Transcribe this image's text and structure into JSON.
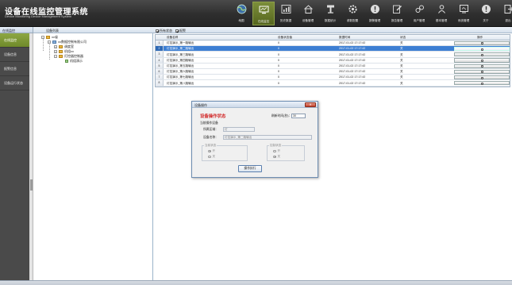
{
  "app": {
    "title": "设备在线监控管理系统",
    "subtitle": "Device Monitoring Device Management System"
  },
  "nav": [
    {
      "label": "地图",
      "icon": "globe-icon",
      "active": false
    },
    {
      "label": "在线监控",
      "icon": "monitor-icon",
      "active": true
    },
    {
      "label": "历史数据",
      "icon": "chart-icon",
      "active": false
    },
    {
      "label": "设备管理",
      "icon": "house-icon",
      "active": false
    },
    {
      "label": "数据统计",
      "icon": "filter-icon",
      "active": false
    },
    {
      "label": "参数配置",
      "icon": "gear-icon",
      "active": false
    },
    {
      "label": "报警管理",
      "icon": "alert-icon",
      "active": false
    },
    {
      "label": "报告管理",
      "icon": "edit-icon",
      "active": false
    },
    {
      "label": "用户管理",
      "icon": "users-icon",
      "active": false
    },
    {
      "label": "基本管理",
      "icon": "user-icon",
      "active": false
    },
    {
      "label": "系统管理",
      "icon": "screen-icon",
      "active": false
    },
    {
      "label": "关于",
      "icon": "info-icon",
      "active": false
    },
    {
      "label": "退出",
      "icon": "exit-icon",
      "active": false
    }
  ],
  "rail": {
    "header": "在线监控",
    "items": [
      {
        "label": "在线监控",
        "active": true
      },
      {
        "label": "设备信息",
        "active": false
      },
      {
        "label": "报警信息",
        "active": false
      },
      {
        "label": "设备运行状态",
        "active": false
      }
    ]
  },
  "tree": {
    "header": "设备列表",
    "nodes": [
      {
        "label": "xx省",
        "kind": "folder"
      },
      {
        "label": "xx数据控制有限公司",
        "kind": "pc"
      },
      {
        "label": "调度室",
        "kind": "folder"
      },
      {
        "label": "机组xx",
        "kind": "folder"
      },
      {
        "label": "灯控器控制器",
        "kind": "folder"
      },
      {
        "label": "机组演示",
        "kind": "dev"
      }
    ]
  },
  "toolbar": {
    "items": [
      {
        "label": "所有状态",
        "checked": true
      },
      {
        "label": "报警",
        "checked": true
      }
    ]
  },
  "grid": {
    "columns": [
      "设备名称",
      "设备状态值",
      "数据时间",
      "状态",
      "操作"
    ],
    "rows": [
      {
        "no": "1",
        "name": "灯控演示_第一路输出",
        "value": "0",
        "time": "2017-01-02  17:17:43",
        "status": "关",
        "selected": false
      },
      {
        "no": "2",
        "name": "灯控演示_第二路输出",
        "value": "0",
        "time": "2017-01-02  17:17:43",
        "status": "关",
        "selected": true
      },
      {
        "no": "3",
        "name": "灯控演示_第三路输出",
        "value": "0",
        "time": "2017-01-02  17:17:43",
        "status": "关",
        "selected": false
      },
      {
        "no": "4",
        "name": "灯控演示_第四路输出",
        "value": "0",
        "time": "2017-01-02  17:17:43",
        "status": "关",
        "selected": false
      },
      {
        "no": "5",
        "name": "灯控演示_第五路输出",
        "value": "0",
        "time": "2017-01-02  17:17:43",
        "status": "关",
        "selected": false
      },
      {
        "no": "6",
        "name": "灯控演示_第六路输出",
        "value": "0",
        "time": "2017-01-02  17:17:43",
        "status": "关",
        "selected": false
      },
      {
        "no": "7",
        "name": "灯控演示_第七路输出",
        "value": "0",
        "time": "2017-01-02  17:17:43",
        "status": "关",
        "selected": false
      },
      {
        "no": "8",
        "name": "灯控演示_第八路输出",
        "value": "0",
        "time": "2017-01-02  17:17:43",
        "status": "关",
        "selected": false
      }
    ]
  },
  "dialog": {
    "title": "设备操作",
    "close_label": "✕",
    "state_text": "设备操作状态",
    "refresh_label": "刷新时间(秒)：",
    "refresh_value": "30",
    "section_label": "当前操作设备",
    "region_label": "所属区域：",
    "region_value": "灯",
    "device_label": "设备名称：",
    "device_value": "灯控演示_第二路输出",
    "group1_title": "当前状态",
    "group1_options": [
      {
        "label": "开",
        "checked": true
      },
      {
        "label": "关",
        "checked": false
      }
    ],
    "group2_title": "控制状态",
    "group2_options": [
      {
        "label": "开",
        "checked": false
      },
      {
        "label": "关",
        "checked": true
      }
    ],
    "button_label": "操作执行"
  }
}
